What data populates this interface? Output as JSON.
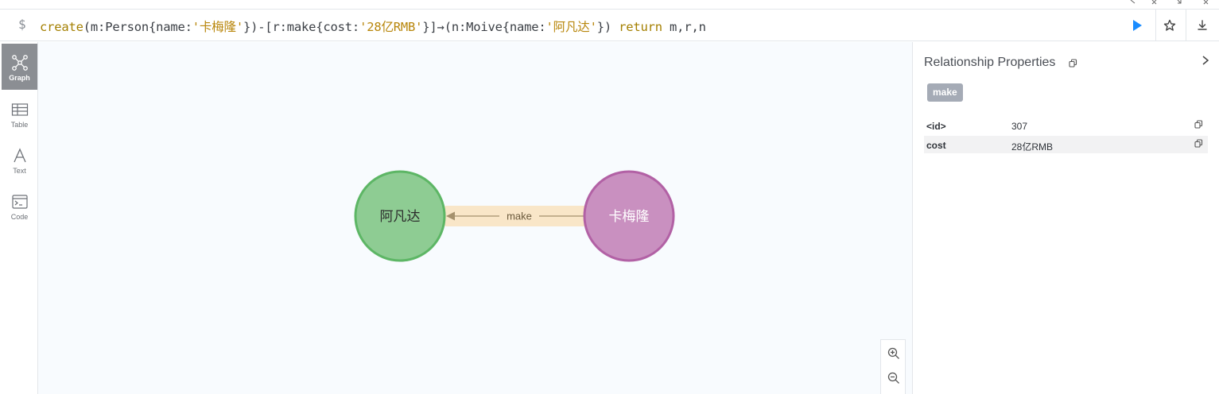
{
  "editor": {
    "prompt": "$",
    "query_parts": {
      "p1": "create",
      "p2": "(m:Person{name:",
      "p3": "'卡梅隆'",
      "p4": "})-[r:make{cost:",
      "p5": "'28亿RMB'",
      "p6": "}]→(n:Moive{name:",
      "p7": "'阿凡达'",
      "p8": "}) ",
      "p9": "return",
      "p10": " m,r,n"
    },
    "run_icon": "play-icon",
    "favorite_icon": "star-icon",
    "download_icon": "download-icon",
    "accent_color": "#1a8cff"
  },
  "sidebar": {
    "items": [
      {
        "label": "Graph",
        "icon": "graph-icon",
        "active": true
      },
      {
        "label": "Table",
        "icon": "table-icon",
        "active": false
      },
      {
        "label": "Text",
        "icon": "text-icon",
        "active": false
      },
      {
        "label": "Code",
        "icon": "code-icon",
        "active": false
      }
    ]
  },
  "graph": {
    "nodes": [
      {
        "label": "阿凡达",
        "color": "#8ecc93",
        "border": "#5db665",
        "text_color": "#2b2b2b"
      },
      {
        "label": "卡梅隆",
        "color": "#c990c0",
        "border": "#b261a5",
        "text_color": "#ffffff"
      }
    ],
    "relationship": {
      "label": "make",
      "highlight_color": "#f9e6c8",
      "line_color": "#a5916d"
    }
  },
  "zoom": {
    "zoom_in_icon": "zoom-in-icon",
    "zoom_out_icon": "zoom-out-icon"
  },
  "panel": {
    "title": "Relationship Properties",
    "badge": "make",
    "properties": [
      {
        "key": "<id>",
        "value": "307"
      },
      {
        "key": "cost",
        "value": "28亿RMB"
      }
    ]
  }
}
